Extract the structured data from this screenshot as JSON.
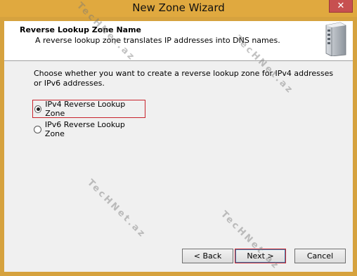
{
  "window": {
    "title": "New Zone Wizard",
    "close_label": "✕"
  },
  "header": {
    "title": "Reverse Lookup Zone Name",
    "subtitle": "A reverse lookup zone translates IP addresses into DNS names."
  },
  "prompt": "Choose whether you want to create a reverse lookup zone for IPv4 addresses or IPv6 addresses.",
  "options": [
    {
      "label": "IPv4 Reverse Lookup Zone",
      "checked": true
    },
    {
      "label": "IPv6 Reverse Lookup Zone",
      "checked": false
    }
  ],
  "buttons": {
    "back": "< Back",
    "next": "Next >",
    "cancel": "Cancel"
  },
  "watermark": "TecHNet.az",
  "icons": {
    "server": "server-icon"
  }
}
